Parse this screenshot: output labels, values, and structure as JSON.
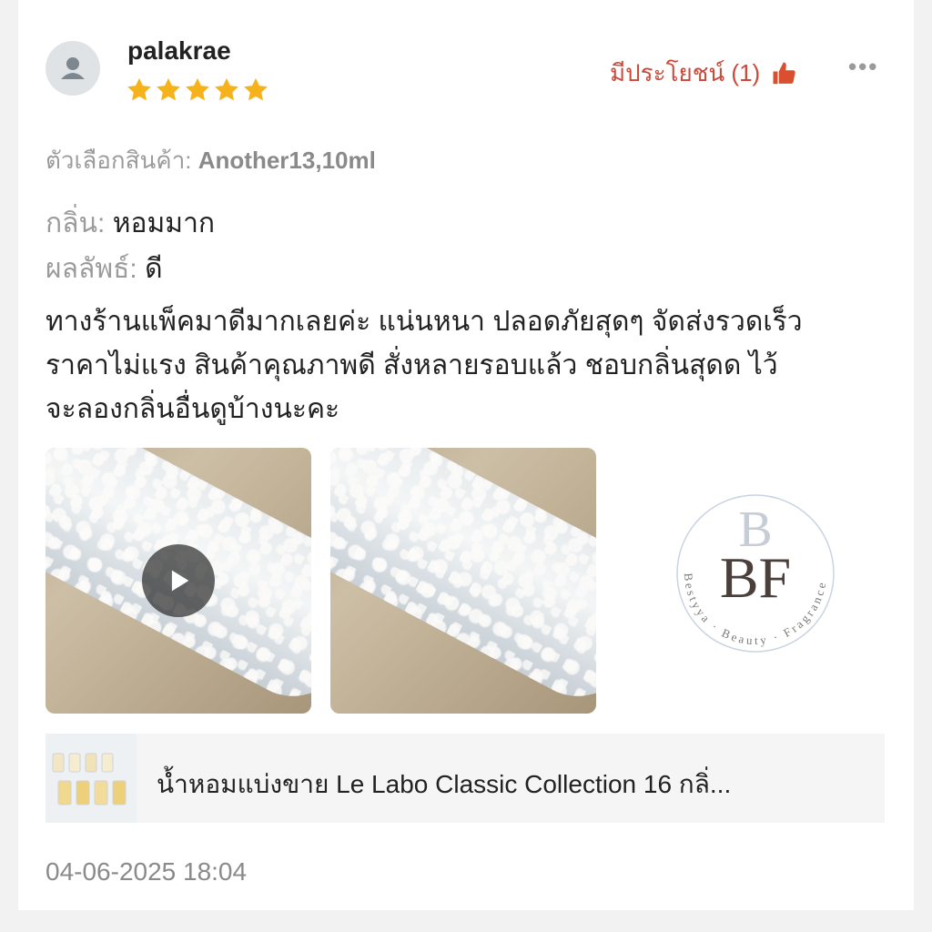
{
  "review": {
    "username": "palakrae",
    "rating": 5,
    "helpful_label": "มีประโยชน์ (1)",
    "more_label": "•••",
    "variation_label": "ตัวเลือกสินค้า:",
    "variation_value": "Another13,10ml",
    "attributes": [
      {
        "label": "กลิ่น:",
        "value": "หอมมาก"
      },
      {
        "label": "ผลลัพธ์:",
        "value": "ดี"
      }
    ],
    "text_lines": [
      "ทางร้านแพ็คมาดีมากเลยค่ะ แน่นหนา ปลอดภัยสุดๆ จัดส่งรวดเร็ว",
      "ราคาไม่แรง สินค้าคุณภาพดี สั่งหลายรอบแล้ว ชอบกลิ่นสุดด ไว้",
      "จะลองกลิ่นอื่นดูบ้างนะคะ"
    ],
    "logo_initials": "BF",
    "logo_ring_text": "Bestyya · Beauty · Fragrance",
    "product_title": "น้ำหอมแบ่งขาย Le Labo Classic Collection 16 กลิ่...",
    "date": "04-06-2025 18:04"
  },
  "colors": {
    "accent": "#c9493a",
    "star": "#f6b21a",
    "muted": "#9b9b9b"
  }
}
